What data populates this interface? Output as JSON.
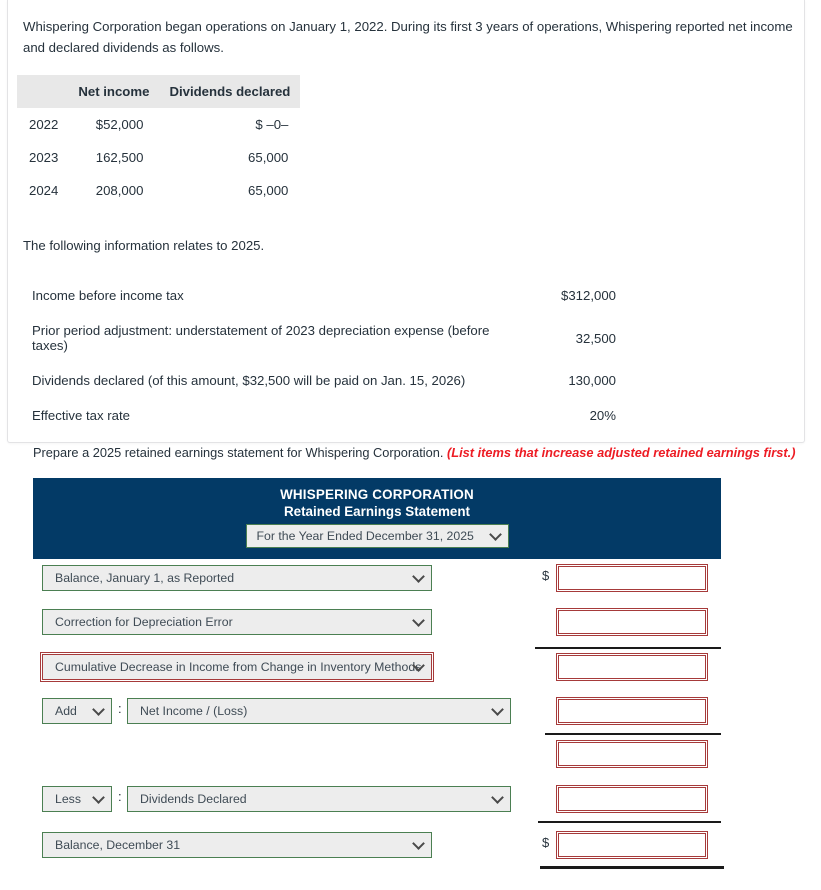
{
  "problem": {
    "intro": "Whispering Corporation began operations on January 1, 2022. During its first 3 years of operations, Whispering reported net income and declared dividends as follows.",
    "history_table": {
      "blank_header": "",
      "headers": [
        "Net income",
        "Dividends declared"
      ],
      "rows": [
        {
          "year": "2022",
          "net_income": "$52,000",
          "dividends": "$ –0–"
        },
        {
          "year": "2023",
          "net_income": "162,500",
          "dividends": "65,000"
        },
        {
          "year": "2024",
          "net_income": "208,000",
          "dividends": "65,000"
        }
      ]
    },
    "relates_line": "The following information relates to 2025.",
    "info_rows": [
      {
        "label": "Income before income tax",
        "value": "$312,000"
      },
      {
        "label": "Prior period adjustment: understatement of 2023 depreciation expense (before taxes)",
        "value": "32,500"
      },
      {
        "label": "Dividends declared (of this amount, $32,500 will be paid on Jan. 15, 2026)",
        "value": "130,000"
      },
      {
        "label": "Effective tax rate",
        "value": "20%"
      }
    ]
  },
  "instruction": {
    "prompt": "Prepare a 2025 retained earnings statement for Whispering Corporation.",
    "hint": "(List items that increase adjusted retained earnings first.)",
    "hint_color": "#ed1c24"
  },
  "statement": {
    "company": "WHISPERING CORPORATION",
    "title": "Retained Earnings Statement",
    "period_select": {
      "value": "For the Year Ended December 31, 2025",
      "icon": "chevron-down-icon"
    },
    "header_bg": "#033a66",
    "valid_border": "#4b7f52",
    "error_border": "#a63a3a",
    "rows": [
      {
        "kind": "single",
        "label": "Balance, January 1, as Reported",
        "state": "valid",
        "dollar": "$",
        "amount_value": "",
        "amount_state": "error",
        "rule": "none"
      },
      {
        "kind": "single",
        "label": "Correction for Depreciation Error",
        "state": "valid",
        "dollar": "",
        "amount_value": "",
        "amount_state": "error",
        "rule": "single"
      },
      {
        "kind": "single",
        "label": "Cumulative Decrease in Income from Change in Inventory Methods",
        "state": "error",
        "dollar": "",
        "amount_value": "",
        "amount_state": "error",
        "rule": "none"
      },
      {
        "kind": "pair",
        "sign": "Add",
        "separator": ":",
        "label": "Net Income / (Loss)",
        "state": "valid",
        "dollar": "",
        "amount_value": "",
        "amount_state": "error",
        "rule": "single"
      },
      {
        "kind": "amount-only",
        "label": "",
        "state": "valid",
        "dollar": "",
        "amount_value": "",
        "amount_state": "error",
        "rule": "none"
      },
      {
        "kind": "pair",
        "sign": "Less",
        "separator": ":",
        "label": "Dividends Declared",
        "state": "valid",
        "dollar": "",
        "amount_value": "",
        "amount_state": "error",
        "rule": "single"
      },
      {
        "kind": "single",
        "label": "Balance, December 31",
        "state": "valid",
        "dollar": "$",
        "amount_value": "",
        "amount_state": "error",
        "rule": "thick"
      }
    ]
  }
}
